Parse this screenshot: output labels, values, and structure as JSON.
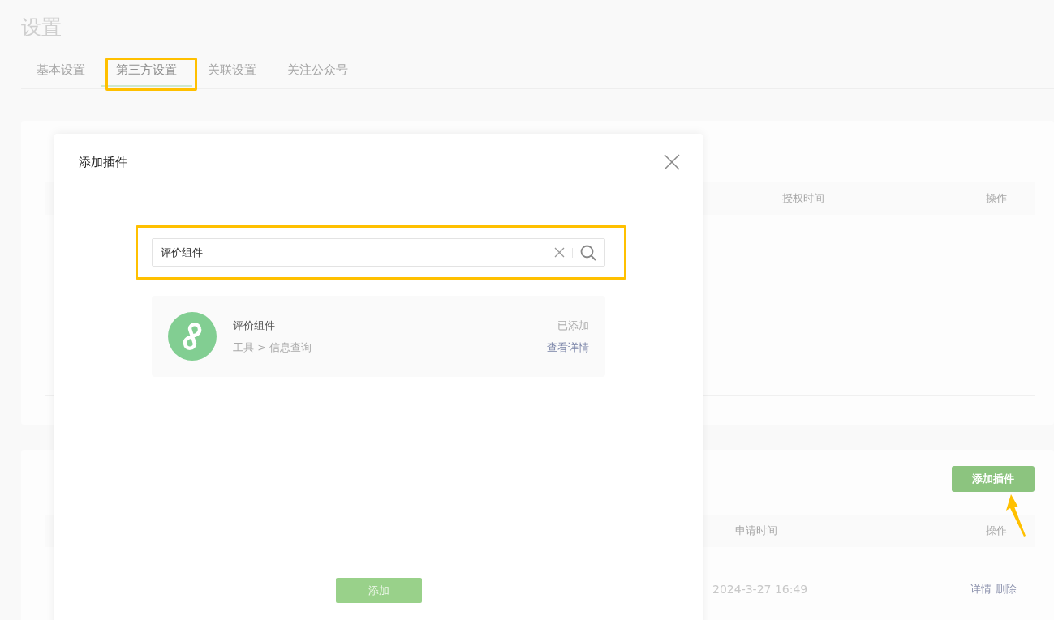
{
  "page": {
    "title": "设置"
  },
  "tabs": [
    {
      "label": "基本设置",
      "selected": false
    },
    {
      "label": "第三方设置",
      "selected": true
    },
    {
      "label": "关联设置",
      "selected": false
    },
    {
      "label": "关注公众号",
      "selected": false
    }
  ],
  "auth_card": {
    "columns": [
      "授权时间",
      "操作"
    ]
  },
  "plugin_card": {
    "add_button": "添加插件",
    "columns": [
      "申请时间",
      "操作"
    ],
    "rows": [
      {
        "time": "2024-3-27 16:49",
        "actions": [
          "详情",
          "删除"
        ]
      }
    ]
  },
  "modal": {
    "title": "添加插件",
    "search": {
      "value": "评价组件"
    },
    "results": [
      {
        "name": "评价组件",
        "category": "工具 > 信息查询",
        "status": "已添加",
        "link": "查看详情"
      }
    ],
    "confirm_button": "添加"
  }
}
